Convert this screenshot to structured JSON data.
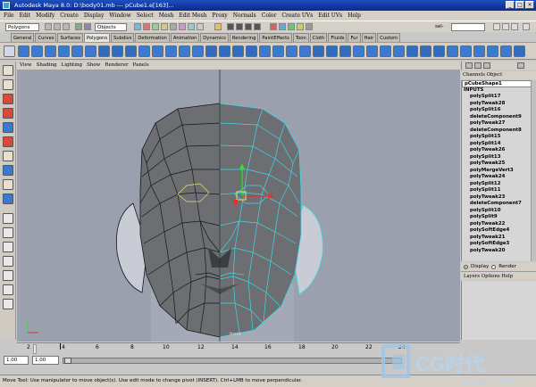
{
  "titlebar": {
    "title": "Autodesk Maya 8.0: D:\\body01.mb    ---  pCube1.e[163]...",
    "minimize": "_",
    "maximize": "□",
    "close": "×"
  },
  "menus": [
    "File",
    "Edit",
    "Modify",
    "Create",
    "Display",
    "Window",
    "Select",
    "Mesh",
    "Edit Mesh",
    "Proxy",
    "Normals",
    "Color",
    "Create UVs",
    "Edit UVs",
    "Help"
  ],
  "status": {
    "mode": "Polygons",
    "objects": "Objects",
    "sel_label": "sel-"
  },
  "shelf_tabs": [
    "General",
    "Curves",
    "Surfaces",
    "Polygons",
    "Subdivs",
    "Deformation",
    "Animation",
    "Dynamics",
    "Rendering",
    "PaintEffects",
    "Toon",
    "Cloth",
    "Fluids",
    "Fur",
    "Hair",
    "Custom"
  ],
  "shelf_active": "Polygons",
  "panel_menu": [
    "View",
    "Shading",
    "Lighting",
    "Show",
    "Renderer",
    "Panels"
  ],
  "channel_box": {
    "tabs": "Channels Object",
    "selected": "pCubeShape1",
    "inputs_header": "INPUTS",
    "inputs": [
      "polySplit17",
      "polyTweak28",
      "polySplit16",
      "deleteComponent9",
      "polyTweak27",
      "deleteComponent8",
      "polySplit15",
      "polySplit14",
      "polyTweak26",
      "polySplit13",
      "polyTweak25",
      "polyMergeVert3",
      "polyTweak24",
      "polySplit12",
      "polySplit11",
      "polyTweak23",
      "deleteComponent7",
      "polySplit10",
      "polySplit9",
      "polyTweak22",
      "polySoftEdge4",
      "polyTweak21",
      "polySoftEdge3",
      "polyTweak20"
    ]
  },
  "layer": {
    "display": "Display",
    "render": "Render",
    "menu": "Layers   Options   Help"
  },
  "camera_label": "front",
  "timeline": {
    "ticks": [
      "2",
      "4",
      "6",
      "8",
      "10",
      "12",
      "14",
      "16",
      "18",
      "20",
      "22",
      "24"
    ]
  },
  "range": {
    "start": "1.00",
    "min": "1.00"
  },
  "help_line": "Move Tool: Use manipulator to move object(s). Use edit mode to change pivot (INSERT). Ctrl+LMB to move perpendicular.",
  "watermark": {
    "text": "CG时代",
    "url": "www.cgtime.com.cn"
  },
  "colors": {
    "viewport_bg": "#9aa0ad",
    "mesh_face": "#6c6e72",
    "wire": "#16171d",
    "selected_wire": "#3fd9e6",
    "title_bar": "#0a2a8a"
  }
}
